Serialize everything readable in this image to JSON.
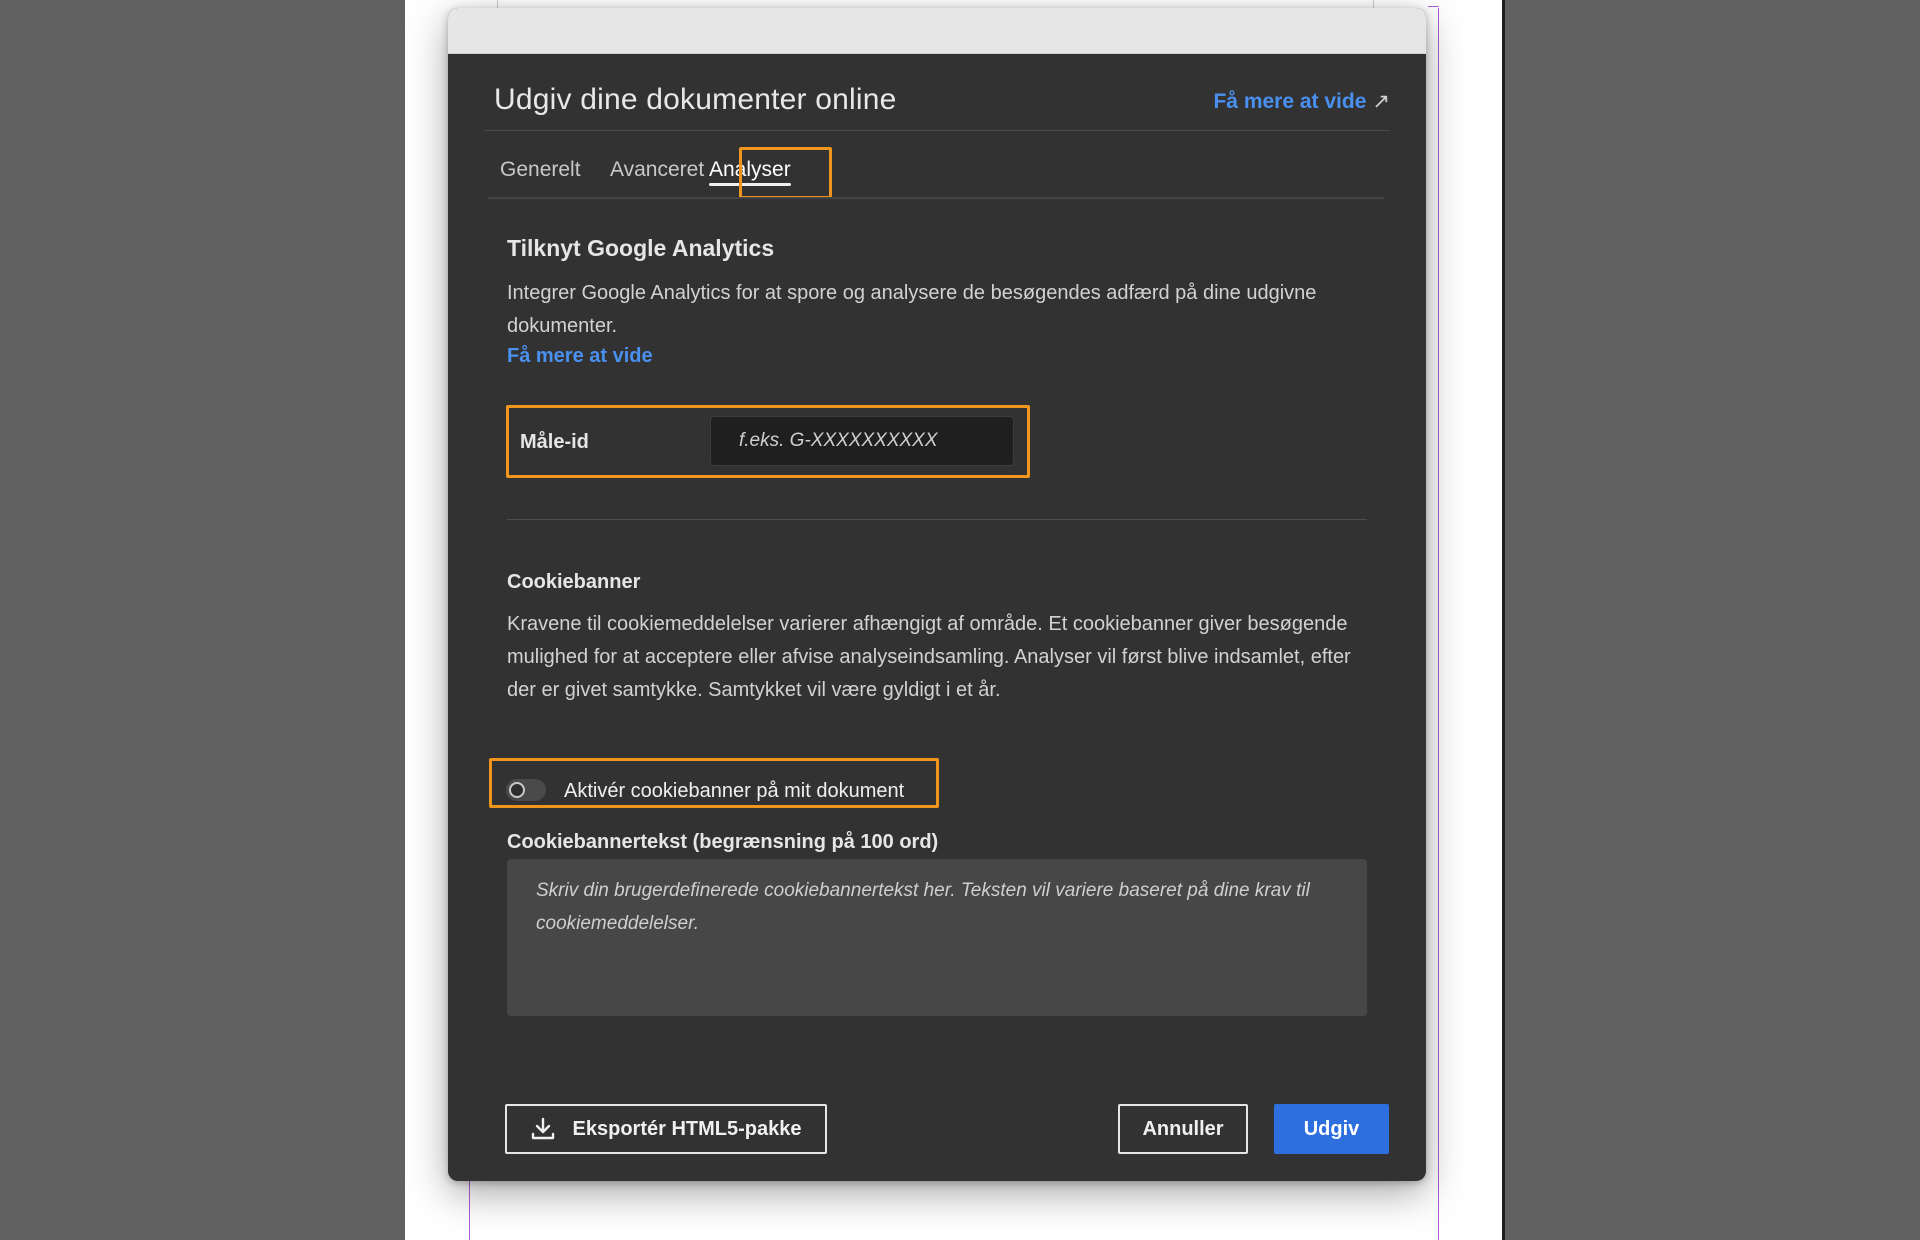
{
  "dialog": {
    "title": "Udgiv dine dokumenter online",
    "learn_more": "Få mere at vide",
    "learn_more_icon": "external-link-arrow-icon"
  },
  "tabs": [
    {
      "label": "Generelt",
      "active": false
    },
    {
      "label": "Avanceret",
      "active": false
    },
    {
      "label": "Analyser",
      "active": true
    }
  ],
  "analytics": {
    "title": "Tilknyt Google Analytics",
    "description": "Integrer Google Analytics for at spore og analysere de besøgendes adfærd på dine udgivne dokumenter.",
    "learn_more": "Få mere at vide",
    "measure_label": "Måle-id",
    "measure_placeholder": "f.eks. G-XXXXXXXXXX",
    "measure_value": ""
  },
  "cookie": {
    "title": "Cookiebanner",
    "description": "Kravene til cookiemeddelelser varierer afhængigt af område. Et cookiebanner giver besøgende mulighed for at acceptere eller afvise analyseindsamling. Analyser vil først blive indsamlet, efter der er givet samtykke. Samtykket vil være gyldigt i et år.",
    "toggle_label": "Aktivér cookiebanner på mit dokument",
    "toggle_on": false,
    "textarea_label": "Cookiebannertekst (begrænsning på 100 ord)",
    "textarea_placeholder": "Skriv din brugerdefinerede cookiebannertekst her. Teksten vil variere baseret på dine krav til cookiemeddelelser.",
    "textarea_value": ""
  },
  "footer": {
    "export_label": "Eksportér HTML5-pakke",
    "export_icon": "download-icon",
    "cancel_label": "Annuller",
    "publish_label": "Udgiv"
  },
  "colors": {
    "dialog_bg": "#323232",
    "link": "#4a90f0",
    "highlight": "#f0961f",
    "primary_button": "#2e6fe0"
  }
}
